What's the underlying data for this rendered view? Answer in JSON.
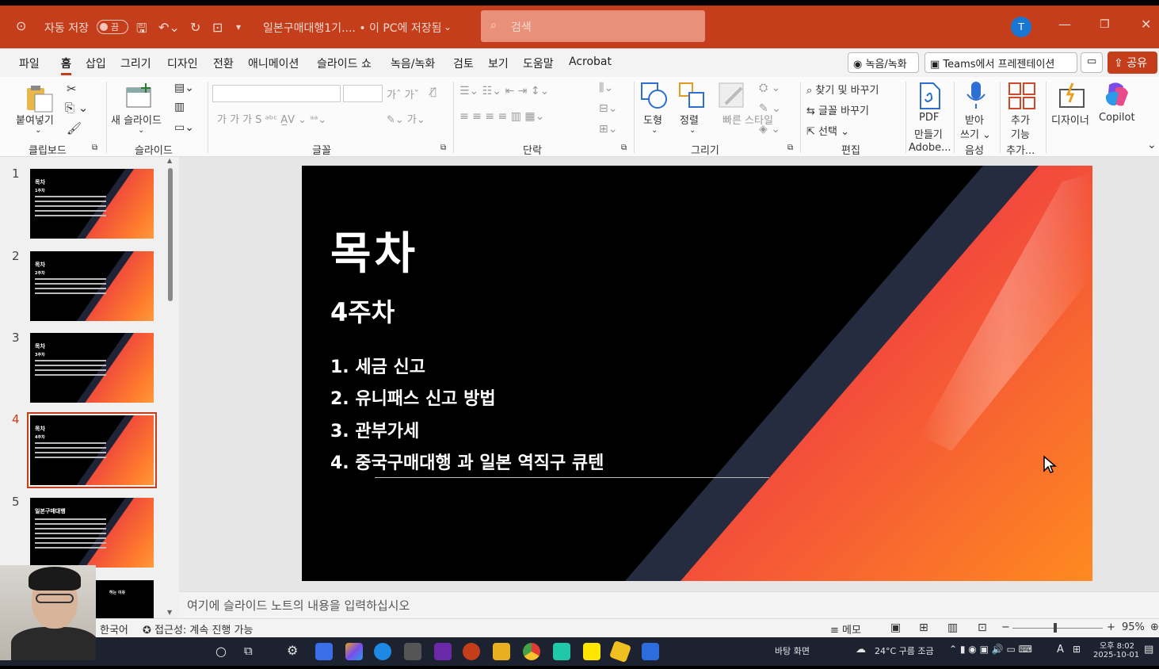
{
  "titlebar": {
    "autosave_label": "자동 저장",
    "autosave_state": "끔",
    "doc_title": "일본구매대행1기.... • 이 PC에 저장됨",
    "search_placeholder": "검색",
    "avatar_initial": "T"
  },
  "menu": {
    "items": [
      "파일",
      "홈",
      "삽입",
      "그리기",
      "디자인",
      "전환",
      "애니메이션",
      "슬라이드 쇼",
      "녹음/녹화",
      "검토",
      "보기",
      "도움말",
      "Acrobat"
    ],
    "record_btn": "녹음/녹화",
    "teams_btn": "Teams에서 프레젠테이션",
    "share_btn": "공유"
  },
  "ribbon": {
    "paste": "붙여넣기",
    "clipboard": "클립보드",
    "new_slide": "새 슬라이드",
    "slide_group": "슬라이드",
    "font_group": "글꼴",
    "paragraph_group": "단락",
    "shape": "도형",
    "arrange": "정렬",
    "quick_style": "빠른 스타일",
    "draw_group": "그리기",
    "find_replace": "찾기 및 바꾸기",
    "replace_font": "글꼴 바꾸기",
    "select": "선택",
    "edit_group": "편집",
    "pdf_create_1": "PDF",
    "pdf_create_2": "만들기",
    "pdf_group": "Adobe...",
    "dictate_1": "받아",
    "dictate_2": "쓰기",
    "voice_group": "음성",
    "addins_1": "추가",
    "addins_2": "기능",
    "addins_group": "추가...",
    "designer": "디자이너",
    "copilot": "Copilot"
  },
  "thumbnails": [
    {
      "num": "1",
      "title": "목차",
      "sub": "1주차"
    },
    {
      "num": "2",
      "title": "목차",
      "sub": "2주차"
    },
    {
      "num": "3",
      "title": "목차",
      "sub": "3주차"
    },
    {
      "num": "4",
      "title": "목차",
      "sub": "4주차"
    },
    {
      "num": "5",
      "title": "일본구매대행",
      "sub": ""
    },
    {
      "num": "",
      "title": "",
      "sub": "하는 이유"
    }
  ],
  "slide": {
    "title": "목차",
    "subtitle": "4주차",
    "items": [
      "1. 세금 신고",
      "2. 유니패스 신고 방법",
      "3. 관부가세",
      "4. 중국구매대행 과 일본 역직구 큐텐"
    ]
  },
  "notes_placeholder": "여기에 슬라이드 노트의 내용을 입력하십시오",
  "status": {
    "language": "한국어",
    "accessibility": "접근성: 계속 진행 가능",
    "memo": "메모",
    "zoom": "95%"
  },
  "taskbar": {
    "desktop_label": "바탕 화면",
    "weather": "24°C 구름 조금",
    "time": "오후 8:02",
    "date": "2025-10-01",
    "ime": "A"
  },
  "colors": {
    "accent": "#c43e1c",
    "slide_bg": "#000000",
    "slide_gradient_start": "#e8364a",
    "slide_gradient_end": "#ff8a2a"
  }
}
